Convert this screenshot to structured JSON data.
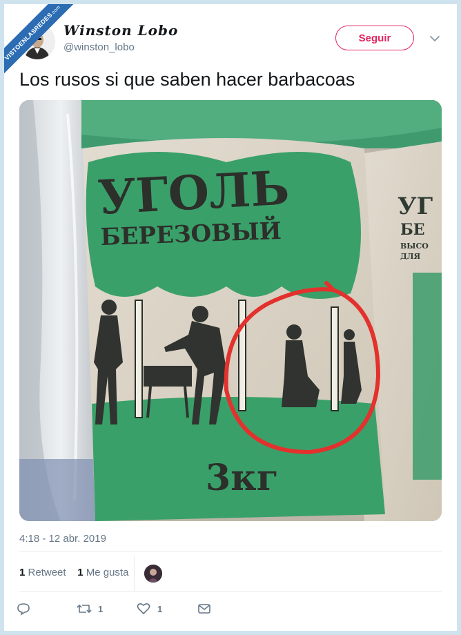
{
  "watermark": {
    "line1": "VISTOENLASREDES",
    "line2": ".com"
  },
  "author": {
    "display_name": "Winston Lobo",
    "handle": "@winston_lobo"
  },
  "follow_label": "Seguir",
  "tweet_text": "Los rusos si que saben hacer barbacoas",
  "photo": {
    "bag_title_line1": "УГОЛЬ",
    "bag_title_line2": "БЕРЕЗОВЫЙ",
    "bag_weight": "3кг",
    "side_bag_line1": "УГ",
    "side_bag_line2": "БЕ",
    "side_bag_small1": "ВЫСО",
    "side_bag_small2": "ДЛЯ"
  },
  "timestamp": "4:18 - 12 abr. 2019",
  "stats": {
    "retweets_count": "1",
    "retweets_label": "Retweet",
    "likes_count": "1",
    "likes_label": "Me gusta"
  },
  "actions": {
    "retweet_count": "1",
    "like_count": "1"
  },
  "colors": {
    "link": "#e0245e",
    "muted": "#657786",
    "text": "#14171a",
    "bag_green": "#3aa06a",
    "circle_red": "#e3312d"
  }
}
